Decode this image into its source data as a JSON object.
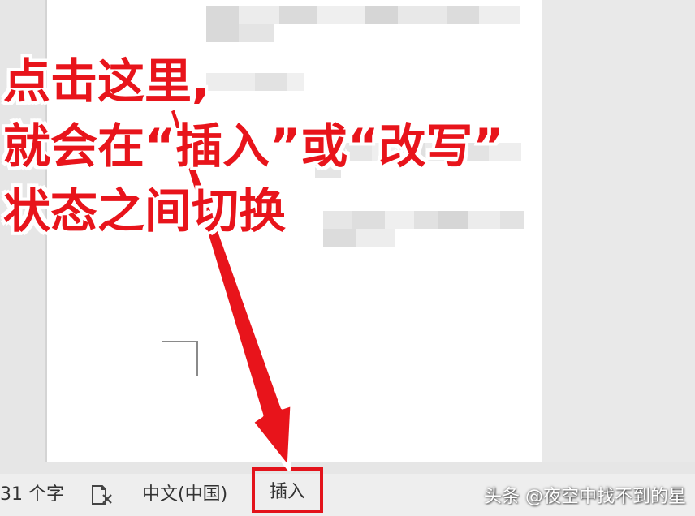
{
  "statusbar": {
    "word_count": "31 个字",
    "proofing_icon": "proofing-error-icon",
    "language": "中文(中国)",
    "mode": "插入"
  },
  "annotation": {
    "line1": "点击这里,",
    "line2": "就会在“插入”或“改写”",
    "line3": "状态之间切换"
  },
  "watermark": "头条 @夜空中找不到的星",
  "colors": {
    "annotation_red": "#e8141b",
    "highlight_box": "#e3131b",
    "statusbar_bg": "#eeeeee"
  }
}
